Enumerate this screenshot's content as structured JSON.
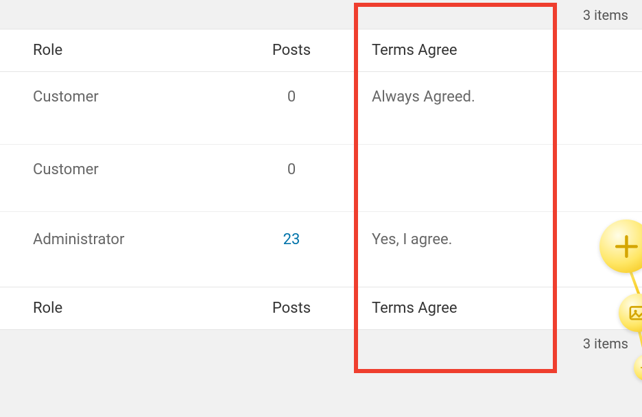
{
  "top_count": "3 items",
  "bottom_count": "3 items",
  "headers": {
    "role": "Role",
    "posts": "Posts",
    "terms": "Terms Agree"
  },
  "footers": {
    "role": "Role",
    "posts": "Posts",
    "terms": "Terms Agree"
  },
  "rows": [
    {
      "role": "Customer",
      "posts": "0",
      "posts_link": false,
      "terms": "Always Agreed."
    },
    {
      "role": "Customer",
      "posts": "0",
      "posts_link": false,
      "terms": ""
    },
    {
      "role": "Administrator",
      "posts": "23",
      "posts_link": true,
      "terms": "Yes, I agree."
    }
  ],
  "highlight": {
    "accent": "#ef3e2e"
  }
}
